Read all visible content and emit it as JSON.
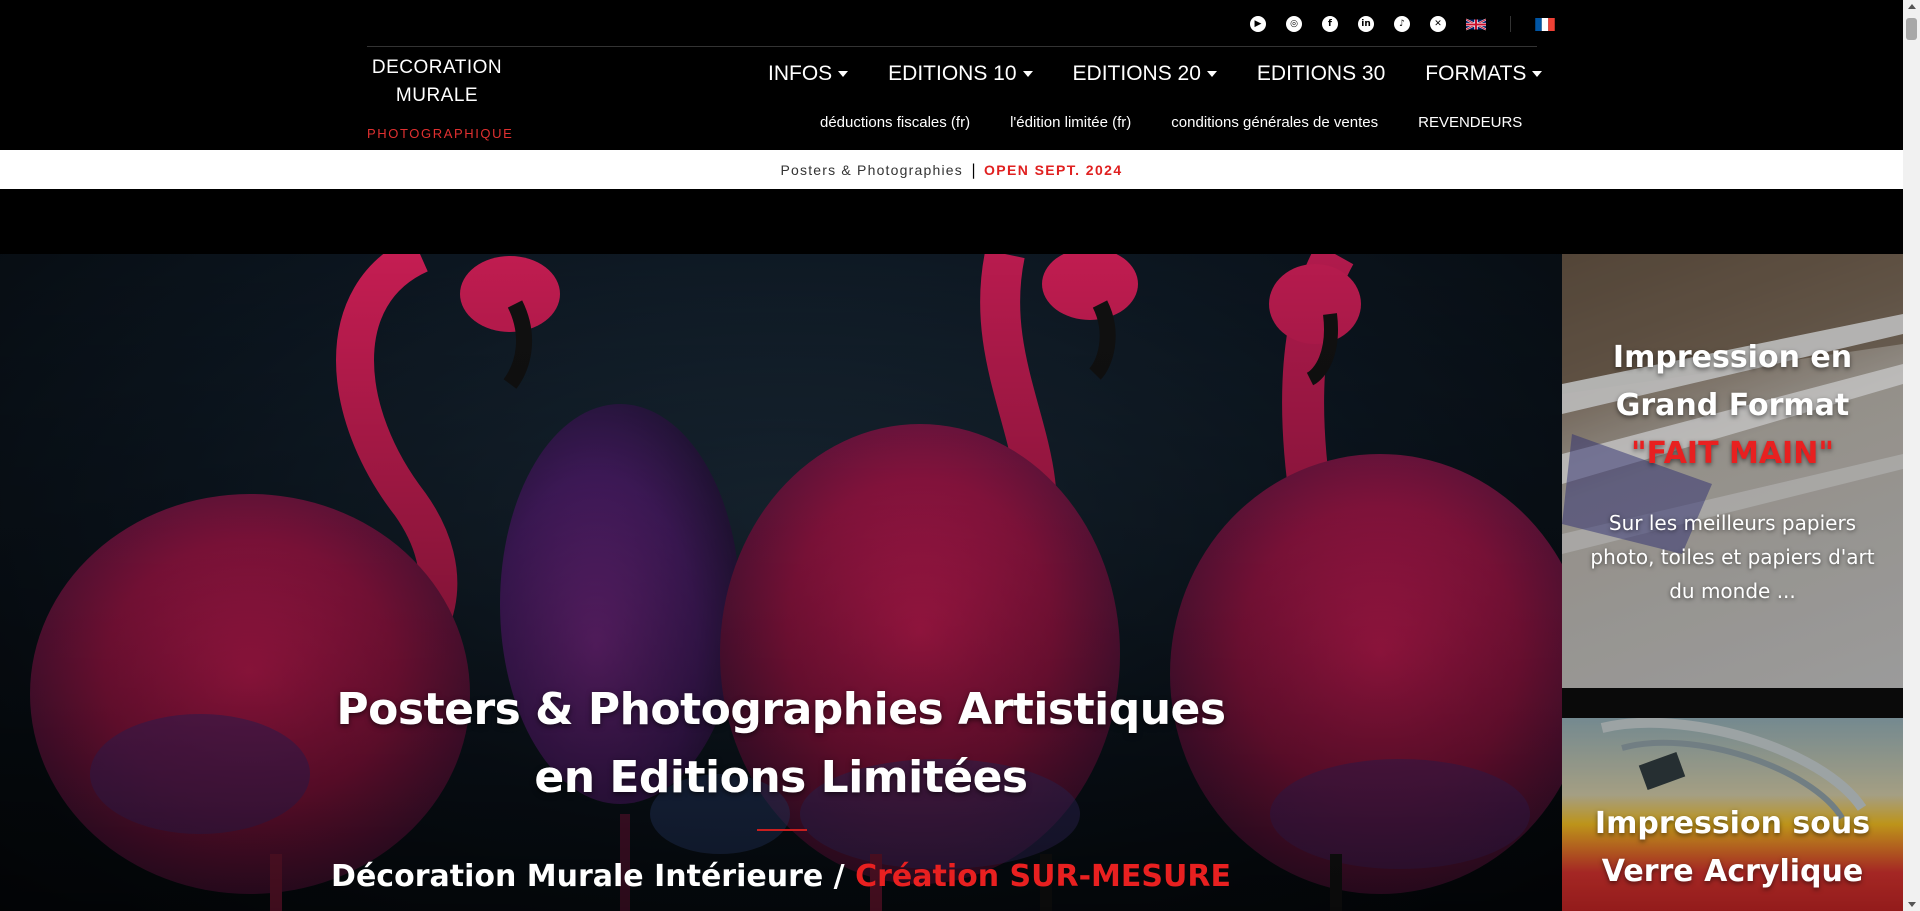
{
  "social": {
    "icons": [
      "youtube-icon",
      "instagram-icon",
      "facebook-icon",
      "linkedin-icon",
      "tiktok-icon",
      "x-icon"
    ],
    "languages": [
      "flag-uk-icon",
      "flag-fr-icon"
    ]
  },
  "logo": {
    "line1": "DECORATION",
    "line2": "MURALE",
    "line3": "PHOTOGRAPHIQUE"
  },
  "nav": {
    "main": [
      {
        "label": "INFOS",
        "dropdown": true
      },
      {
        "label": "EDITIONS 10",
        "dropdown": true
      },
      {
        "label": "EDITIONS 20",
        "dropdown": true
      },
      {
        "label": "EDITIONS 30",
        "dropdown": false
      },
      {
        "label": "FORMATS",
        "dropdown": true
      }
    ],
    "sub": [
      {
        "label": "déductions fiscales (fr)"
      },
      {
        "label": "l'édition limitée (fr)"
      },
      {
        "label": "conditions générales de ventes"
      },
      {
        "label": "REVENDEURS"
      }
    ]
  },
  "announcement": {
    "text": "Posters & Photographies",
    "separator": "|",
    "highlight": "OPEN SEPT. 2024"
  },
  "hero": {
    "title_line1": "Posters & Photographies Artistiques",
    "title_line2": "en Editions Limitées",
    "subtitle_white": "Décoration Murale Intérieure / ",
    "subtitle_red": "Création SUR-MESURE"
  },
  "cards": [
    {
      "title_line1": "Impression en",
      "title_line2": "Grand Format",
      "title_red": "\"FAIT MAIN\"",
      "desc_line1": "Sur les meilleurs papiers",
      "desc_line2": "photo, toiles et papiers d'art",
      "desc_line3": "du monde ..."
    },
    {
      "title_line1": "Impression sous",
      "title_line2": "Verre Acrylique"
    }
  ],
  "colors": {
    "accent_red": "#e82020",
    "background": "#000000",
    "announce_bg": "#ffffff"
  }
}
